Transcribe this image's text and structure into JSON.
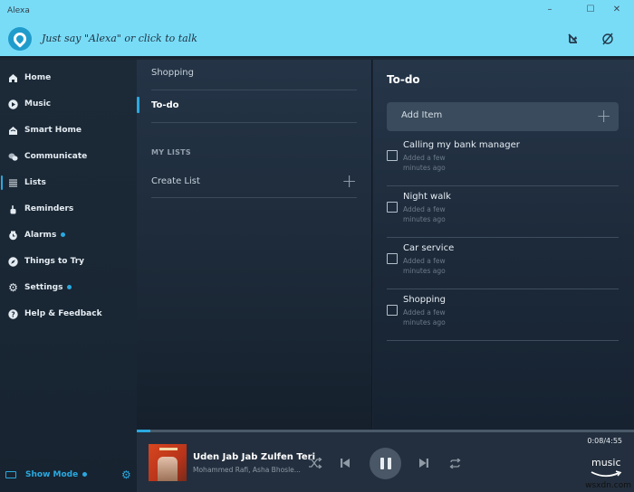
{
  "window": {
    "title": "Alexa",
    "controls": {
      "minimize": "–",
      "maximize": "☐",
      "close": "✕"
    }
  },
  "header": {
    "prompt": "Just say \"Alexa\" or click to talk",
    "icons": [
      "do-not-disturb-icon",
      "mic-off-icon"
    ]
  },
  "sidebar": {
    "items": [
      {
        "label": "Home",
        "icon": "home-icon",
        "active": false,
        "dot": false
      },
      {
        "label": "Music",
        "icon": "play-circle-icon",
        "active": false,
        "dot": false
      },
      {
        "label": "Smart Home",
        "icon": "smart-home-icon",
        "active": false,
        "dot": false
      },
      {
        "label": "Communicate",
        "icon": "chat-bubbles-icon",
        "active": false,
        "dot": false
      },
      {
        "label": "Lists",
        "icon": "list-icon",
        "active": true,
        "dot": false
      },
      {
        "label": "Reminders",
        "icon": "reminder-hand-icon",
        "active": false,
        "dot": false
      },
      {
        "label": "Alarms",
        "icon": "alarm-clock-icon",
        "active": false,
        "dot": true
      },
      {
        "label": "Things to Try",
        "icon": "compass-icon",
        "active": false,
        "dot": false
      },
      {
        "label": "Settings",
        "icon": "gear-icon",
        "active": false,
        "dot": true
      },
      {
        "label": "Help & Feedback",
        "icon": "help-icon",
        "active": false,
        "dot": false
      }
    ],
    "show_mode": {
      "label": "Show Mode",
      "dot": true
    }
  },
  "lists": {
    "default_lists": [
      {
        "label": "Shopping",
        "active": false
      },
      {
        "label": "To-do",
        "active": true
      }
    ],
    "my_lists_heading": "MY LISTS",
    "create_list_label": "Create List"
  },
  "detail": {
    "title": "To-do",
    "add_item_placeholder": "Add Item",
    "items": [
      {
        "title": "Calling my bank manager",
        "added": "Added a few minutes ago",
        "checked": false
      },
      {
        "title": "Night walk",
        "added": "Added a few minutes ago",
        "checked": false
      },
      {
        "title": "Car service",
        "added": "Added a few minutes ago",
        "checked": false
      },
      {
        "title": "Shopping",
        "added": "Added a few minutes ago",
        "checked": false
      }
    ]
  },
  "player": {
    "track_title": "Uden Jab Jab Zulfen Teri",
    "artist": "Mohammed Rafi, Asha Bhosle...",
    "elapsed": "0:08",
    "duration": "4:55",
    "time_display": "0:08/4:55",
    "progress_fraction": 0.027,
    "state": "playing",
    "service_logo": "music"
  },
  "watermark": "wsxdn.com",
  "colors": {
    "header_bg": "#79dcf7",
    "accent": "#2aa9e0",
    "sidebar_bg": "#1c2a38",
    "player_bg": "#232f3e"
  }
}
